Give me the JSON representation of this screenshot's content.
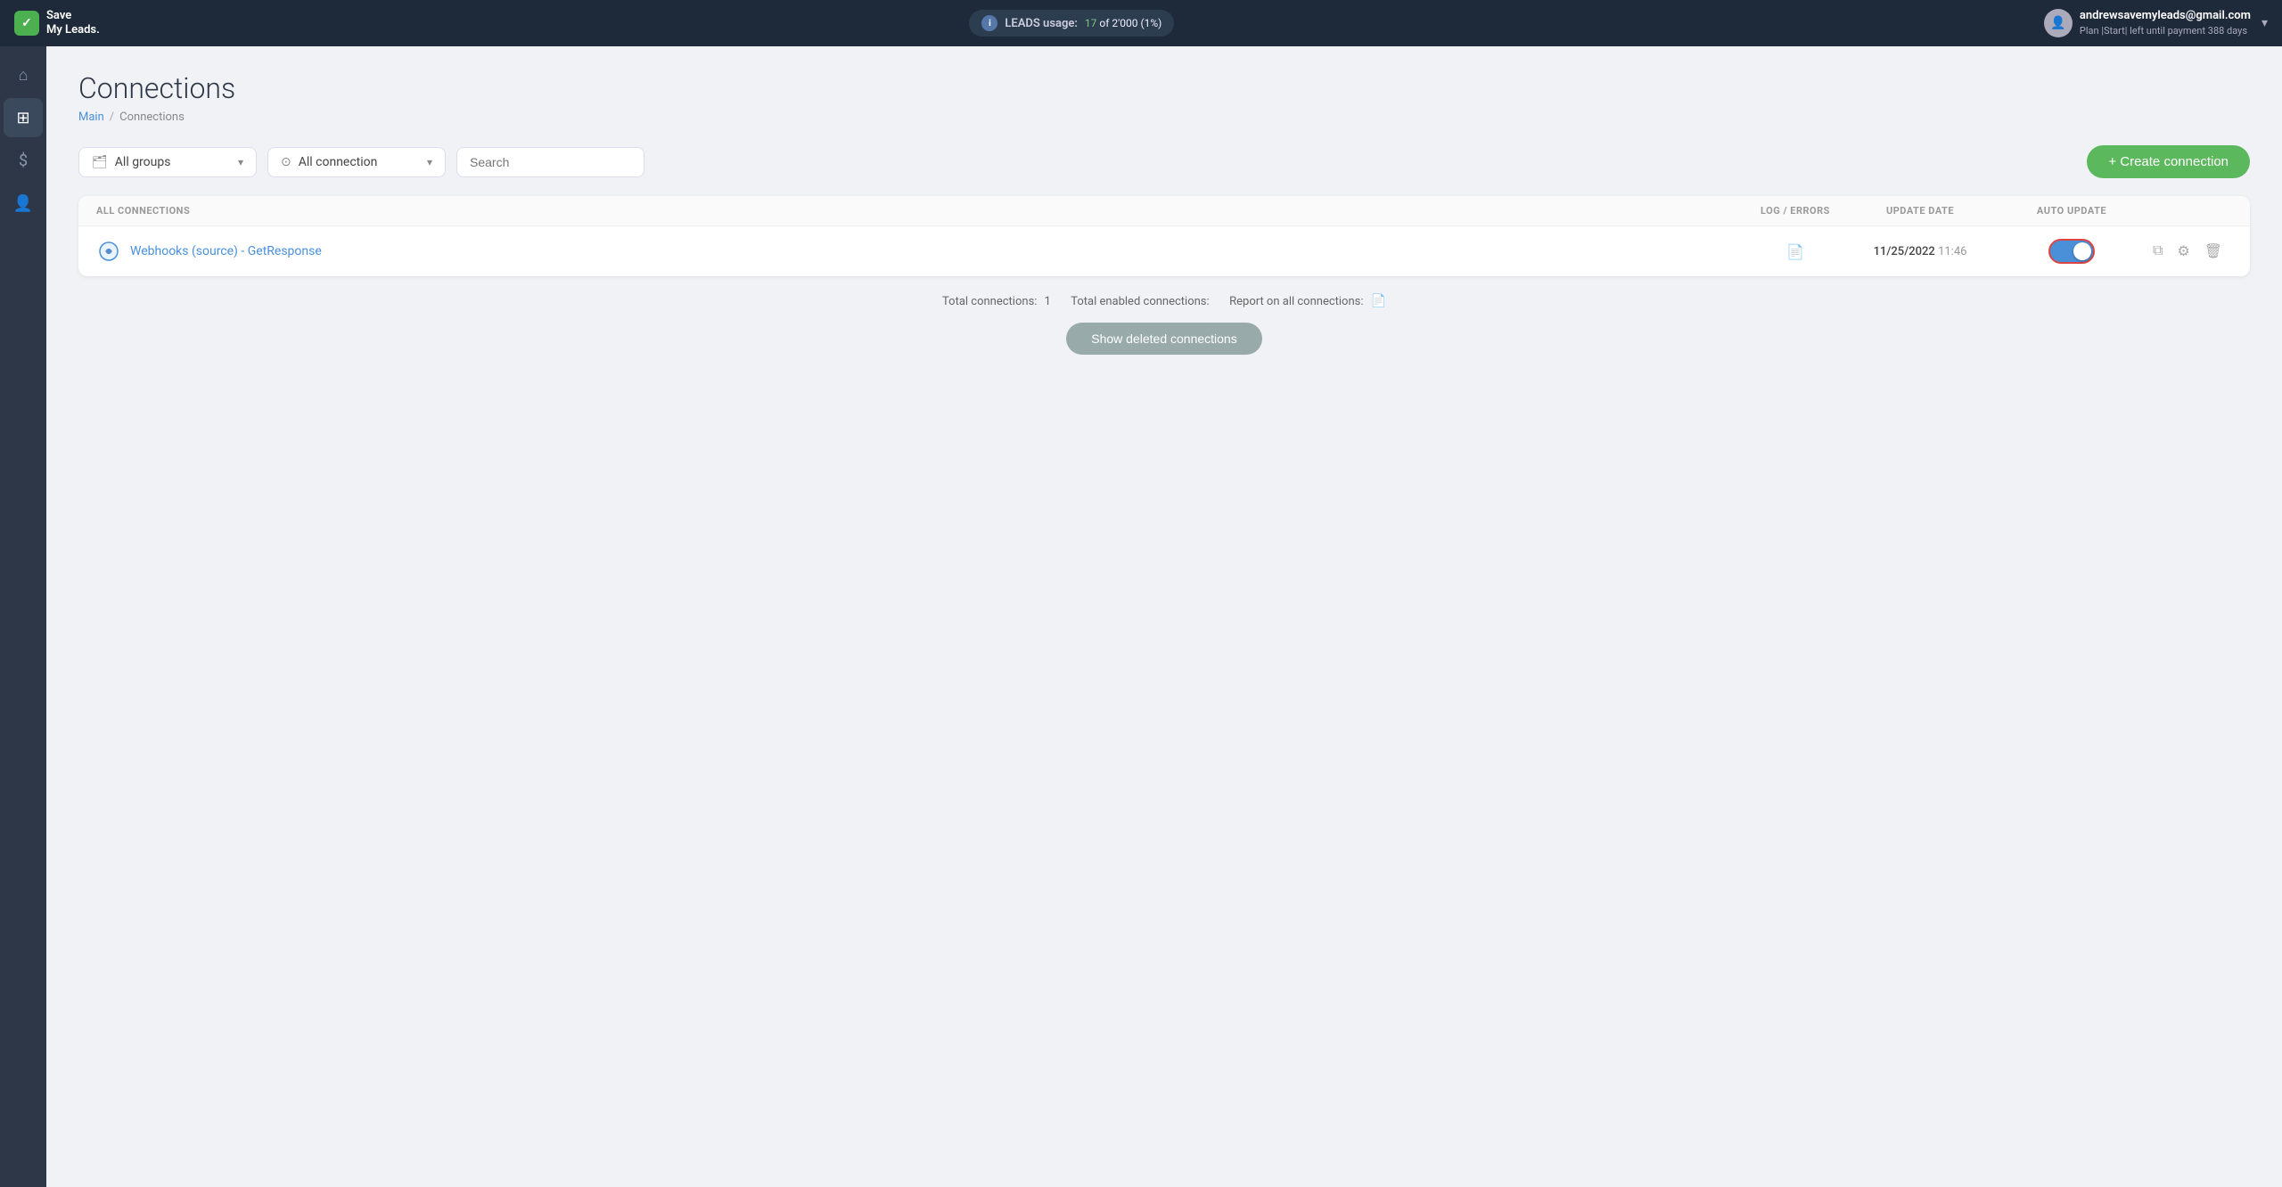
{
  "header": {
    "logo_line1": "Save",
    "logo_line2": "My Leads.",
    "leads_label": "LEADS usage:",
    "leads_current": "17",
    "leads_total": "2'000",
    "leads_percent": "(1%)",
    "user_email": "andrewsavemyleads@gmail.com",
    "user_plan": "Plan |Start| left until payment",
    "user_days": "388 days",
    "chevron": "▾"
  },
  "sidebar": {
    "items": [
      {
        "name": "home",
        "icon": "⌂",
        "label": "Home"
      },
      {
        "name": "connections",
        "icon": "⊞",
        "label": "Connections"
      },
      {
        "name": "billing",
        "icon": "$",
        "label": "Billing"
      },
      {
        "name": "account",
        "icon": "👤",
        "label": "Account"
      }
    ]
  },
  "page": {
    "title": "Connections",
    "breadcrumb_main": "Main",
    "breadcrumb_sep": "/",
    "breadcrumb_current": "Connections"
  },
  "filters": {
    "group_icon": "📁",
    "group_label": "All groups",
    "connection_icon": "⊙",
    "connection_label": "All connection",
    "search_placeholder": "Search",
    "create_label": "+ Create connection"
  },
  "table": {
    "col_all_connections": "ALL CONNECTIONS",
    "col_log_errors": "LOG / ERRORS",
    "col_update_date": "UPDATE DATE",
    "col_auto_update": "AUTO UPDATE",
    "rows": [
      {
        "name": "Webhooks (source) - GetResponse",
        "update_date": "11/25/2022",
        "update_time": "11:46",
        "auto_update": true
      }
    ]
  },
  "footer": {
    "total_label": "Total connections:",
    "total_value": "1",
    "enabled_label": "Total enabled connections:",
    "report_label": "Report on all connections:",
    "show_deleted": "Show deleted connections"
  }
}
